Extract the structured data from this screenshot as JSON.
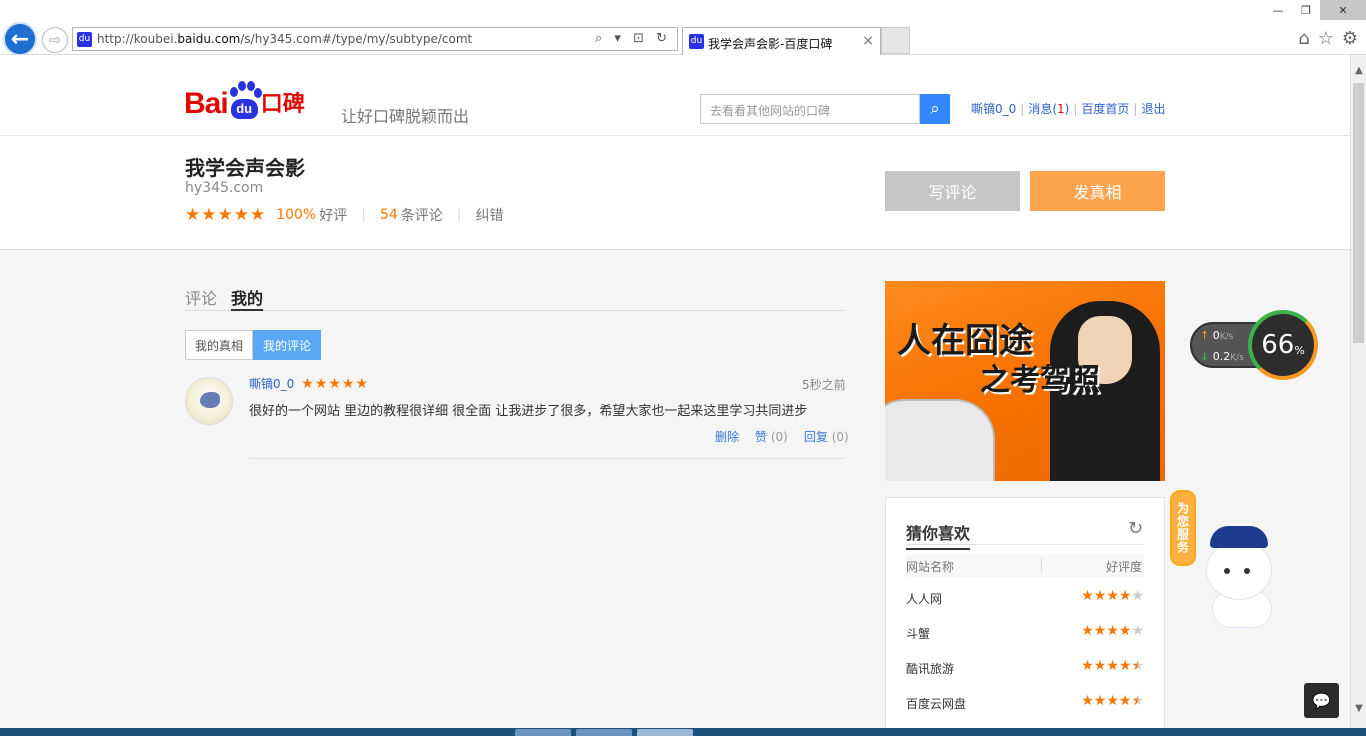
{
  "browser": {
    "url_prefix": "http://koubei.",
    "url_host": "baidu.com",
    "url_path": "/s/hy345.com#/type/my/subtype/comt",
    "url_controls": "⌕ ▾ ⊡ ↻",
    "tab_title": "我学会声会影-百度口碑",
    "tab_close": "×",
    "back_icon": "←",
    "forward_icon": "⇨",
    "favicon": "du",
    "win_min": "—",
    "win_max": "❐",
    "win_close": "✕",
    "home_icon": "⌂",
    "star_icon": "☆",
    "gear_icon": "⚙"
  },
  "header": {
    "logo_bai": "Bai",
    "logo_du": "du",
    "logo_koubei": "口碑",
    "slogan": "让好口碑脱颖而出",
    "search_placeholder": "去看看其他网站的口碑",
    "search_icon": "⌕",
    "user_name": "嘶镝0_0",
    "messages_label": "消息(",
    "messages_count": "1",
    "messages_close": ")",
    "home_link": "百度首页",
    "logout_link": "退出",
    "sep": "|"
  },
  "site": {
    "title": "我学会声会影",
    "domain": "hy345.com",
    "stars": "★★★★★",
    "good_rate_num": "100%",
    "good_rate_label": "好评",
    "review_count_num": "54",
    "review_count_label": "条评论",
    "report_label": "纠错",
    "pipe": "|",
    "write_review": "写评论",
    "post_truth": "发真相"
  },
  "tabs": {
    "comments": "评论",
    "mine": "我的",
    "my_truth": "我的真相",
    "my_reviews": "我的评论"
  },
  "review": {
    "user": "嘶镝0_0",
    "stars": "★★★★★",
    "time": "5秒之前",
    "text": "很好的一个网站 里边的教程很详细 很全面  让我进步了很多，希望大家也一起来这里学习共同进步",
    "delete": "删除",
    "like": "赞",
    "like_count": "(0)",
    "reply": "回复",
    "reply_count": "(0)"
  },
  "ad": {
    "line1": "人在囧途",
    "line2": "之考驾照"
  },
  "recommend": {
    "title": "猜你喜欢",
    "refresh_icon": "↻",
    "col_name": "网站名称",
    "col_rating": "好评度",
    "rows": [
      {
        "name": "人人网",
        "rating": 4
      },
      {
        "name": "斗蟹",
        "rating": 4
      },
      {
        "name": "酷讯旅游",
        "rating": 4.5
      },
      {
        "name": "百度云网盘",
        "rating": 4.5
      }
    ]
  },
  "widgets": {
    "up_speed": "0",
    "down_speed": "0.2",
    "speed_unit": "K/s",
    "up_arrow": "↑",
    "down_arrow": "↓",
    "percent": "66",
    "percent_sign": "%",
    "serve_label": "为您服务",
    "chat_icon": "💬"
  },
  "colors": {
    "accent_orange": "#f77800",
    "baidu_red": "#e10601",
    "baidu_blue": "#2932e1",
    "link_blue": "#2b63c9",
    "tab_active": "#5aa8f5"
  }
}
